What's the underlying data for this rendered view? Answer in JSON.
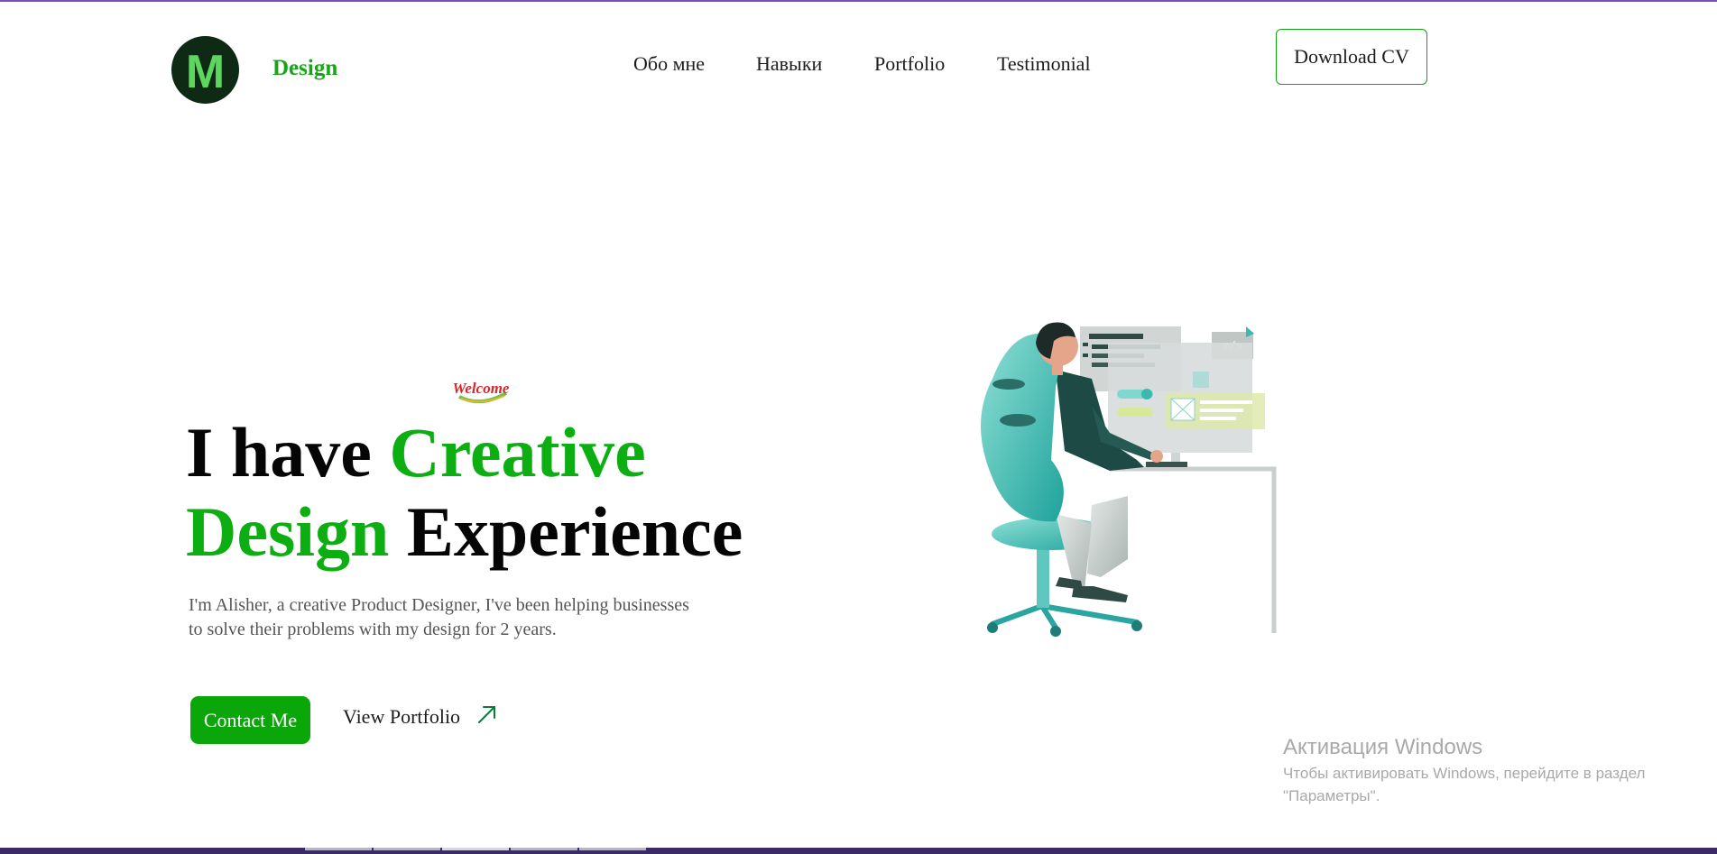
{
  "header": {
    "logo_letter": "M",
    "brand": "Design",
    "nav": [
      {
        "label": "Обо мне"
      },
      {
        "label": "Навыки"
      },
      {
        "label": "Portfolio"
      },
      {
        "label": "Testimonial"
      }
    ],
    "download_label": "Download CV"
  },
  "hero": {
    "welcome_badge": "Welcome",
    "headline": {
      "part1": "I have ",
      "part2": "Creative",
      "part3": "Design",
      "part4": " Experience"
    },
    "description_line1": "I'm Alisher, a creative Product Designer, I've been helping businesses",
    "description_line2": "to solve their problems with my design for 2 years.",
    "contact_label": "Contact Me",
    "portfolio_label": "View Portfolio",
    "code_tag": "</>"
  },
  "windows_activation": {
    "title": "Активация Windows",
    "line1": "Чтобы активировать Windows, перейдите в раздел",
    "line2": "\"Параметры\"."
  },
  "colors": {
    "accent_green": "#0cae12",
    "logo_dark": "#0f2a14",
    "logo_letter": "#5cd65c",
    "teal": "#3db8b0"
  }
}
